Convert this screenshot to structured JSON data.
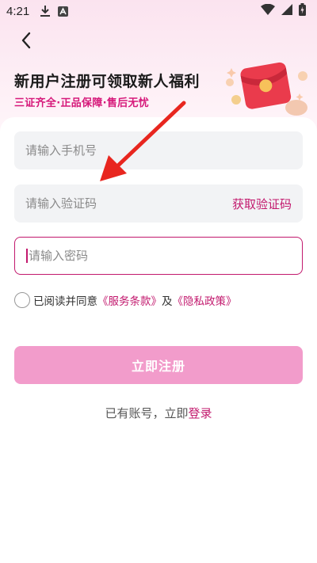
{
  "status_bar": {
    "time": "4:21",
    "left_icons": [
      "download-icon",
      "app-notification-icon"
    ],
    "right_icons": [
      "wifi-icon",
      "signal-icon",
      "battery-charging-icon"
    ]
  },
  "header": {
    "back_icon": "chevron-left-icon",
    "promo_title": "新用户注册可领取新人福利",
    "promo_subtitle": "三证齐全·正品保障·售后无忧"
  },
  "form": {
    "phone_placeholder": "请输入手机号",
    "code_placeholder": "请输入验证码",
    "get_code_label": "获取验证码",
    "password_placeholder": "请输入密码",
    "agreement": {
      "prefix": "已阅读并同意",
      "service_terms": "《服务条款》",
      "conjunction": "及",
      "privacy_policy": "《隐私政策》",
      "checked": false
    },
    "submit_label": "立即注册",
    "login_prompt": "已有账号，立即",
    "login_link": "登录"
  },
  "colors": {
    "accent": "#c2186d",
    "button_bg": "#f29ccb",
    "subtitle": "#d6187a",
    "arrow": "#e8261f"
  }
}
